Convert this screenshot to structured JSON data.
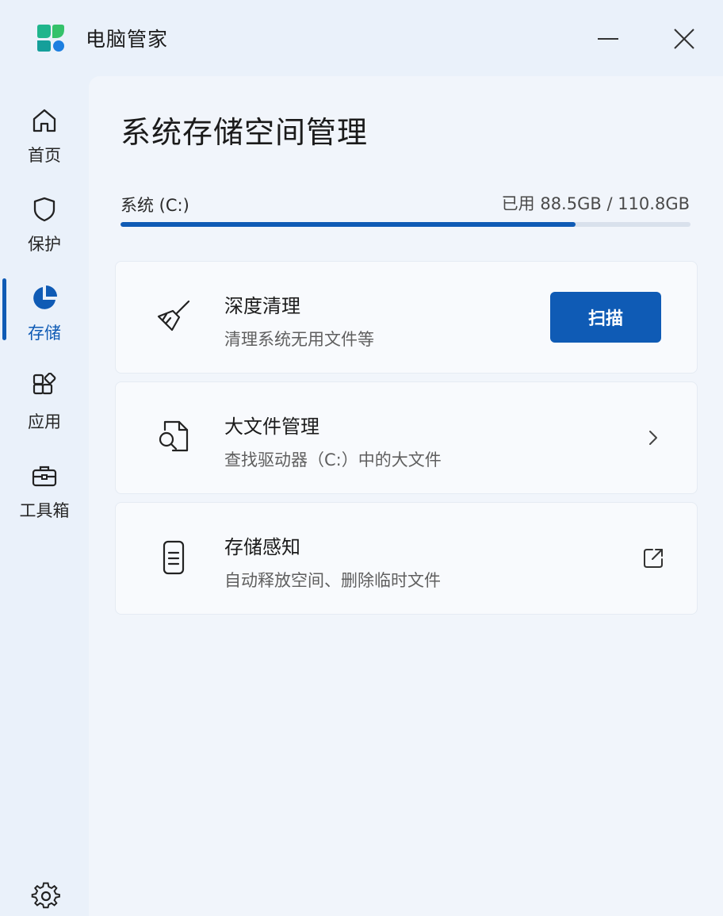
{
  "app": {
    "title": "电脑管家"
  },
  "window": {
    "minimize_icon": "minimize-icon",
    "close_icon": "close-icon"
  },
  "sidebar": {
    "items": [
      {
        "label": "首页",
        "icon": "home-icon",
        "active": false
      },
      {
        "label": "保护",
        "icon": "shield-icon",
        "active": false
      },
      {
        "label": "存储",
        "icon": "pie-chart-icon",
        "active": true
      },
      {
        "label": "应用",
        "icon": "apps-icon",
        "active": false
      },
      {
        "label": "工具箱",
        "icon": "toolbox-icon",
        "active": false
      }
    ],
    "settings_icon": "gear-icon"
  },
  "main": {
    "title": "系统存储空间管理",
    "drive": {
      "label": "系统 (C:)",
      "usage_text": "已用 88.5GB / 110.8GB",
      "used_fraction": 0.799
    },
    "cards": [
      {
        "title": "深度清理",
        "subtitle": "清理系统无用文件等",
        "icon": "broom-icon",
        "action_label": "扫描"
      },
      {
        "title": "大文件管理",
        "subtitle": "查找驱动器（C:）中的大文件",
        "icon": "file-search-icon",
        "action_icon": "chevron-right-icon"
      },
      {
        "title": "存储感知",
        "subtitle": "自动释放空间、删除临时文件",
        "icon": "phone-storage-icon",
        "action_icon": "external-link-icon"
      }
    ]
  },
  "colors": {
    "accent": "#0f5bb5",
    "background": "#eaf1fa",
    "panel": "#f1f5fb"
  }
}
